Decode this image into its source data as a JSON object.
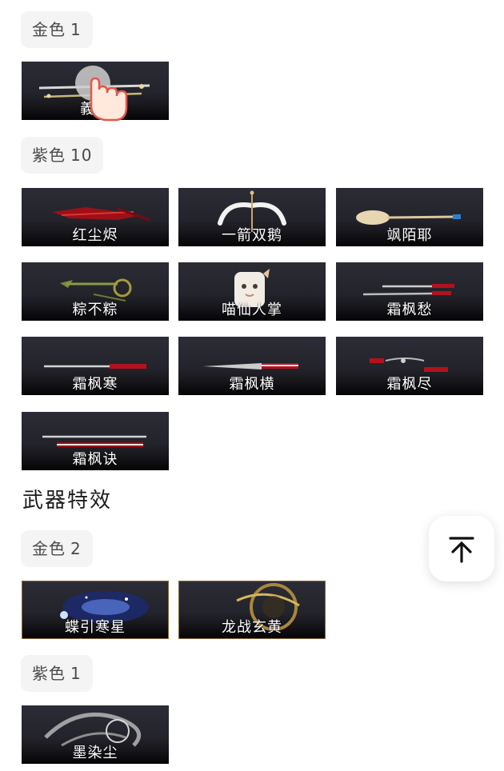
{
  "sections": {
    "skins_gold": {
      "label": "金色",
      "count": "1",
      "items": [
        "義和"
      ]
    },
    "skins_purple": {
      "label": "紫色",
      "count": "10",
      "items": [
        "红尘烬",
        "一箭双鹅",
        "飒陌耶",
        "粽不粽",
        "喵仙人掌",
        "霜枫愁",
        "霜枫寒",
        "霜枫横",
        "霜枫尽",
        "霜枫诀"
      ]
    },
    "effects": {
      "title": "武器特效",
      "gold": {
        "label": "金色",
        "count": "2",
        "items": [
          "蝶引寒星",
          "龙战玄黄"
        ]
      },
      "purple": {
        "label": "紫色",
        "count": "1",
        "items": [
          "墨染尘"
        ]
      }
    }
  },
  "back_to_top": {
    "icon": "arrow-up-to-top-icon"
  },
  "overlay": {
    "icon": "tap-hand-icon"
  },
  "colors": {
    "card_bg": "#23232b",
    "chip_bg": "#f4f4f4",
    "accent_red": "#b3121c",
    "gold_border": "#8a6a3a"
  }
}
